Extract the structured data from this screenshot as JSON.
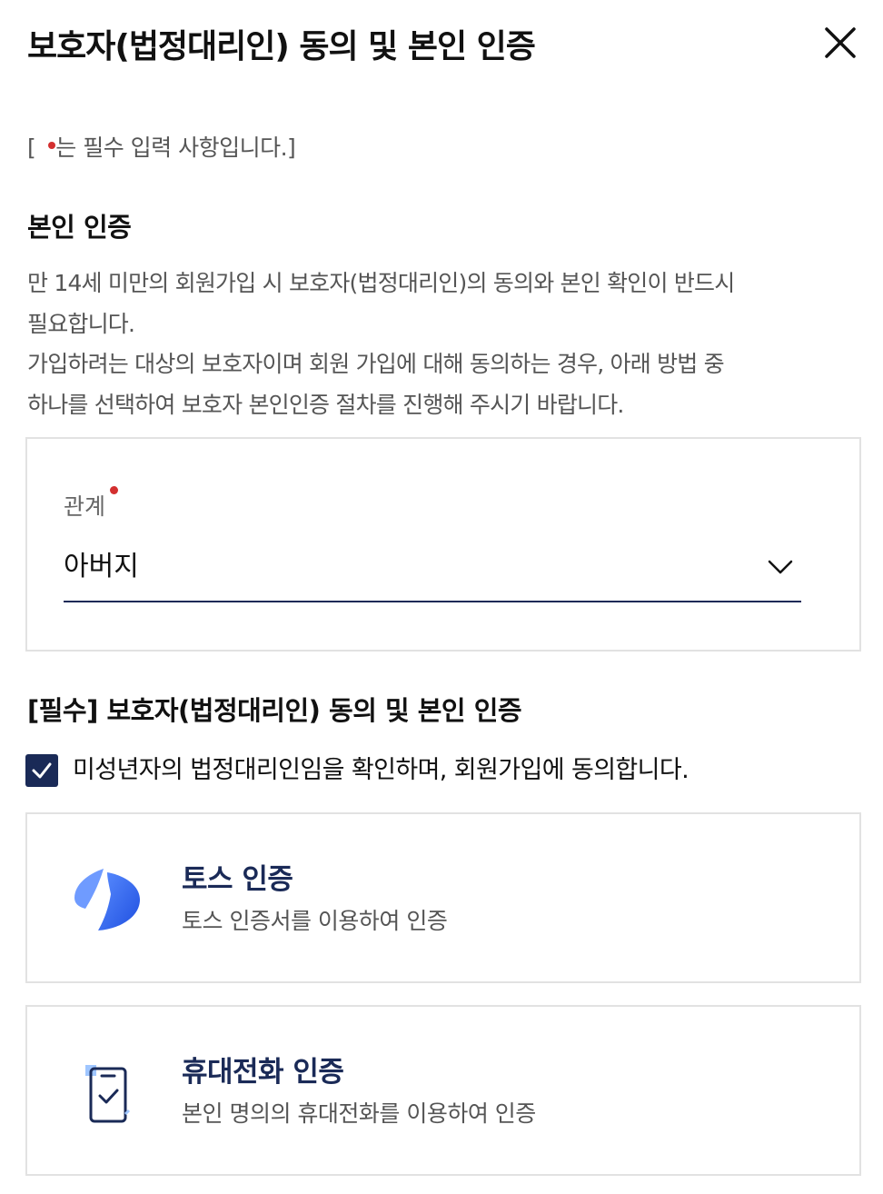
{
  "header": {
    "title": "보호자(법정대리인) 동의 및 본인 인증",
    "close_icon": "close-icon"
  },
  "required_note": {
    "prefix": "[",
    "text": "는 필수 입력 사항입니다.]"
  },
  "identity_section": {
    "title": "본인 인증",
    "description_lines": [
      "만 14세 미만의 회원가입 시 보호자(법정대리인)의 동의와 본인 확인이 반드시",
      "필요합니다.",
      "가입하려는 대상의 보호자이며 회원 가입에 대해 동의하는 경우, 아래 방법 중",
      "하나를 선택하여 보호자 본인인증 절차를 진행해 주시기 바랍니다."
    ]
  },
  "relation": {
    "label": "관계",
    "selected_value": "아버지"
  },
  "consent_section": {
    "title": "[필수] 보호자(법정대리인) 동의 및 본인 인증",
    "checkbox_label": "미성년자의 법정대리인임을 확인하며, 회원가입에 동의합니다.",
    "checked": true
  },
  "auth_options": [
    {
      "icon": "toss-logo-icon",
      "title": "토스 인증",
      "subtitle": "토스 인증서를 이용하여 인증"
    },
    {
      "icon": "phone-check-icon",
      "title": "휴대전화 인증",
      "subtitle": "본인 명의의 휴대전화를 이용하여 인증"
    }
  ],
  "colors": {
    "accent_navy": "#1a2a57",
    "required_red": "#d32f2f",
    "toss_blue": "#2f6bff",
    "border_gray": "#e2e2e2"
  }
}
